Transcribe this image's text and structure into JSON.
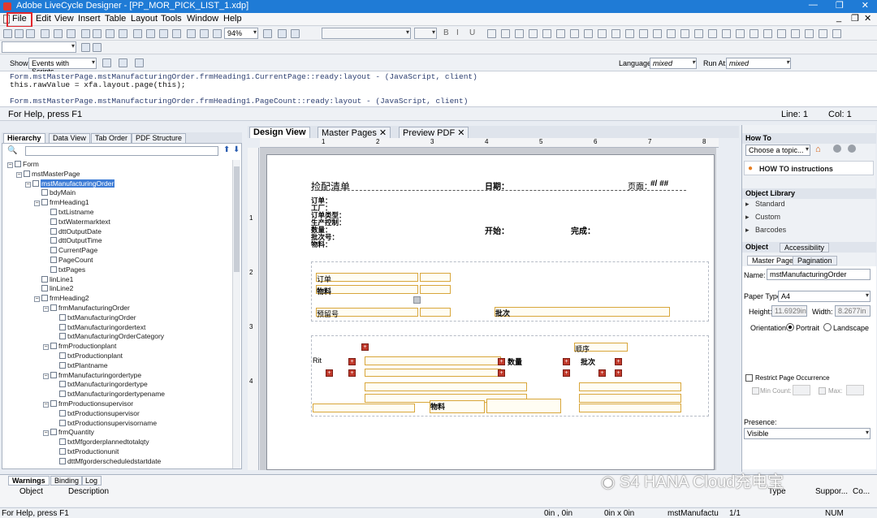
{
  "window": {
    "title": "Adobe LiveCycle Designer - [PP_MOR_PICK_LIST_1.xdp]",
    "controls": [
      "—",
      "❐",
      "✕"
    ]
  },
  "menu": [
    "File",
    "Edit",
    "View",
    "Insert",
    "Table",
    "Layout",
    "Tools",
    "Window",
    "Help"
  ],
  "toolbar": {
    "zoom": "94%"
  },
  "script_bar": {
    "show_label": "Show:",
    "show_value": "Events with Scripts",
    "language_label": "Language:",
    "language_value": "mixed",
    "run_at_label": "Run At:",
    "run_at_value": "mixed"
  },
  "script_lines": [
    "Form.mstMasterPage.mstManufacturingOrder.frmHeading1.CurrentPage::ready:layout - (JavaScript, client)",
    "this.rawValue = xfa.layout.page(this);",
    "",
    "Form.mstMasterPage.mstManufacturingOrder.frmHeading1.PageCount::ready:layout - (JavaScript, client)"
  ],
  "help_bar": {
    "text": "For Help, press F1",
    "line": "Line: 1",
    "col": "Col: 1"
  },
  "left_tabs": [
    "Hierarchy",
    "Data View",
    "Tab Order",
    "PDF Structure"
  ],
  "tree": [
    {
      "label": "Form",
      "level": 0,
      "exp": "−"
    },
    {
      "label": "mstMasterPage",
      "level": 1,
      "exp": "−"
    },
    {
      "label": "mstManufacturingOrder",
      "level": 2,
      "exp": "−",
      "sel": true
    },
    {
      "label": "bdyMain",
      "level": 3
    },
    {
      "label": "frmHeading1",
      "level": 3,
      "exp": "−"
    },
    {
      "label": "txtListname",
      "level": 4
    },
    {
      "label": "txtWatermarktext",
      "level": 4
    },
    {
      "label": "dttOutputDate",
      "level": 4
    },
    {
      "label": "dttOutputTime",
      "level": 4
    },
    {
      "label": "CurrentPage",
      "level": 4
    },
    {
      "label": "PageCount",
      "level": 4
    },
    {
      "label": "txtPages",
      "level": 4
    },
    {
      "label": "linLine1",
      "level": 3
    },
    {
      "label": "linLine2",
      "level": 3
    },
    {
      "label": "frmHeading2",
      "level": 3,
      "exp": "−"
    },
    {
      "label": "frmManufacturingOrder",
      "level": 4,
      "exp": "−"
    },
    {
      "label": "txtManufacturingOrder",
      "level": 5
    },
    {
      "label": "txtManufacturingordertext",
      "level": 5
    },
    {
      "label": "txtManufacturingOrderCategory",
      "level": 5
    },
    {
      "label": "frmProductionplant",
      "level": 4,
      "exp": "−"
    },
    {
      "label": "txtProductionplant",
      "level": 5
    },
    {
      "label": "txtPlantname",
      "level": 5
    },
    {
      "label": "frmManufacturingordertype",
      "level": 4,
      "exp": "−"
    },
    {
      "label": "txtManufacturingordertype",
      "level": 5
    },
    {
      "label": "txtManufacturingordertypename",
      "level": 5
    },
    {
      "label": "frmProductionsupervisor",
      "level": 4,
      "exp": "−"
    },
    {
      "label": "txtProductionsupervisor",
      "level": 5
    },
    {
      "label": "txtProductionsupervisorname",
      "level": 5
    },
    {
      "label": "frmQuantity",
      "level": 4,
      "exp": "−"
    },
    {
      "label": "txtMfgorderplannedtotalqty",
      "level": 5
    },
    {
      "label": "txtProductionunit",
      "level": 5
    },
    {
      "label": "dttMfgorderscheduledstartdate",
      "level": 5
    }
  ],
  "center_tabs": [
    "Design View",
    "Master Pages",
    "Preview PDF"
  ],
  "ruler": [
    "1",
    "2",
    "3",
    "4",
    "5",
    "6",
    "7",
    "8"
  ],
  "vruler": [
    "1",
    "2",
    "3",
    "4"
  ],
  "page": {
    "title": "捡配清单",
    "date_label": "日期：",
    "page_label": "页面：",
    "page_value": "#/ ##",
    "left_labels": [
      "订单：",
      "工厂：",
      "订单类型：",
      "生产控制：",
      "数量：",
      "批次号：",
      "物料："
    ],
    "start_label": "开始：",
    "finish_label": "完成：",
    "order": "订单",
    "material": "物料",
    "reserved": "预留号",
    "batch": "批次",
    "seq": "顺序",
    "rit": "Rit",
    "qty": "数量",
    "batch2": "批次",
    "material2": "物料"
  },
  "right": {
    "howto_title": "How To",
    "howto_combo": "Choose a topic...",
    "howto_link": "HOW TO instructions",
    "objlib_title": "Object Library",
    "objlib_items": [
      "Standard",
      "Custom",
      "Barcodes"
    ],
    "object_title": "Object",
    "accessibility": "Accessibility",
    "subtabs": [
      "Master Page",
      "Pagination"
    ],
    "name_label": "Name:",
    "name_value": "mstManufacturingOrder",
    "paper_label": "Paper Type:",
    "paper_value": "A4",
    "height_label": "Height:",
    "height_value": "11.6929in",
    "width_label": "Width:",
    "width_value": "8.2677in",
    "orient_label": "Orientation",
    "portrait": "Portrait",
    "landscape": "Landscape",
    "restrict": "Restrict Page Occurrence",
    "min_count": "Min Count:",
    "max": "Max:",
    "presence_label": "Presence:",
    "presence_value": "Visible"
  },
  "bottom": {
    "tabs": [
      "Warnings",
      "Binding",
      "Log"
    ],
    "cols": [
      "Object",
      "Description",
      "Type",
      "Suppor...",
      "Co..."
    ]
  },
  "status": {
    "help": "For Help, press F1",
    "pos": "0in , 0in",
    "size": "0in x 0in",
    "obj": "mstManufactu",
    "pages": "1/1",
    "num": "NUM"
  },
  "watermark": "S4 HANA Cloud充电宝"
}
